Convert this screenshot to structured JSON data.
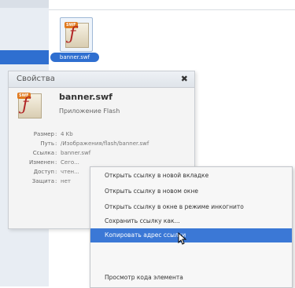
{
  "file": {
    "icon": "flash-file-icon",
    "badge": "SWF",
    "label": "banner.swf"
  },
  "panel": {
    "title": "Свойства",
    "close": "✖",
    "file_name": "banner.swf",
    "file_type": "Приложение Flash",
    "props": [
      {
        "key": "Размер",
        "value": "4 Kb"
      },
      {
        "key": "Путь",
        "value": "/Изображения/flash/banner.swf"
      },
      {
        "key": "Ссылка",
        "value": "banner.swf"
      },
      {
        "key": "Изменен",
        "value": "Сего..."
      },
      {
        "key": "Доступ",
        "value": "чтен..."
      },
      {
        "key": "Защита",
        "value": "нет"
      }
    ]
  },
  "context_menu": {
    "items": [
      "Открыть ссылку в новой вкладке",
      "Открыть ссылку в новом окне",
      "Открыть ссылку в окне в режиме инкогнито",
      "Сохранить ссылку как...",
      "Копировать адрес ссылки",
      "",
      "Просмотр кода элемента"
    ],
    "highlighted_index": 4
  },
  "colors": {
    "accent": "#2f6fd0",
    "highlight": "#3b78d6"
  }
}
